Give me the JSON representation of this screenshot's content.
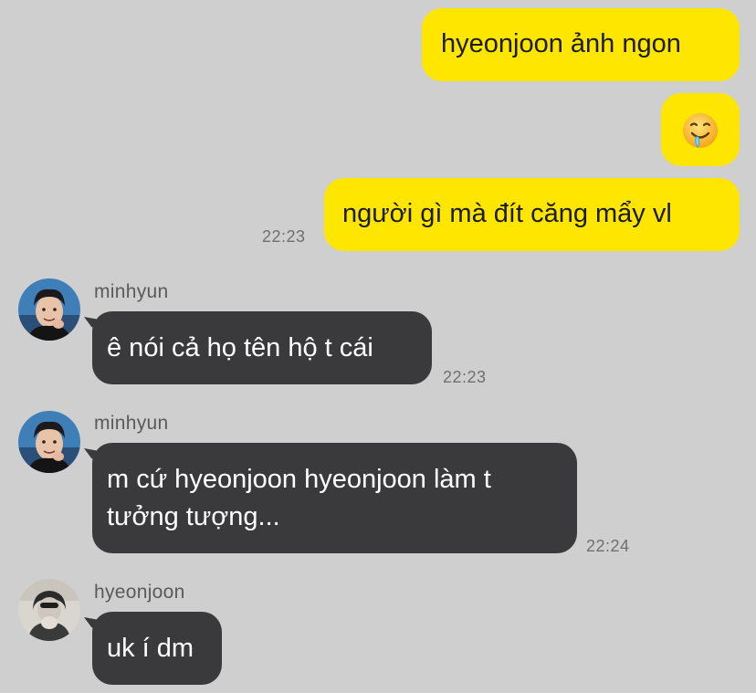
{
  "messages_out": [
    {
      "text": "hyeonjoon ảnh ngon"
    },
    {
      "emoji": "drooling-face"
    },
    {
      "text": "người gì mà đít căng mẩy vl",
      "time": "22:23"
    }
  ],
  "messages_in": [
    {
      "sender": "minhyun",
      "text": "ê nói cả họ tên hộ t cái",
      "time": "22:23"
    },
    {
      "sender": "minhyun",
      "line1": "m cứ hyeonjoon hyeonjoon làm t",
      "line2": "tưởng tượng...",
      "time": "22:24"
    },
    {
      "sender": "hyeonjoon",
      "text": "uk í dm"
    }
  ],
  "colors": {
    "background": "#cfcfcf",
    "outgoing_bubble": "#ffe600",
    "incoming_bubble": "#3a3a3c",
    "timestamp": "#6f6f6f"
  }
}
